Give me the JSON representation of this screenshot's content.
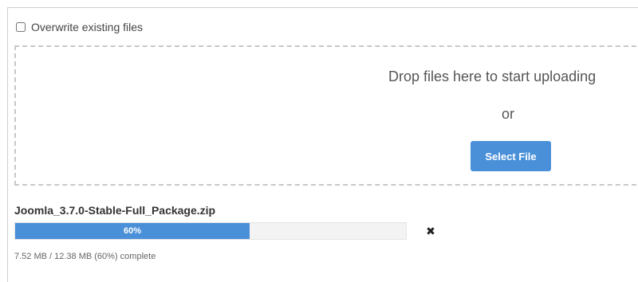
{
  "upload": {
    "overwrite_label": "Overwrite existing files",
    "overwrite_checked": false,
    "dropzone": {
      "prompt": "Drop files here to start uploading",
      "or_text": "or",
      "select_button_label": "Select File"
    },
    "file": {
      "name": "Joomla_3.7.0-Stable-Full_Package.zip",
      "progress_fraction": 0.6,
      "progress_label": "60%",
      "status": "7.52 MB / 12.38 MB (60%) complete",
      "cancel_icon": "close-icon"
    },
    "colors": {
      "accent": "#4a90d9",
      "track": "#f3f3f3"
    }
  }
}
